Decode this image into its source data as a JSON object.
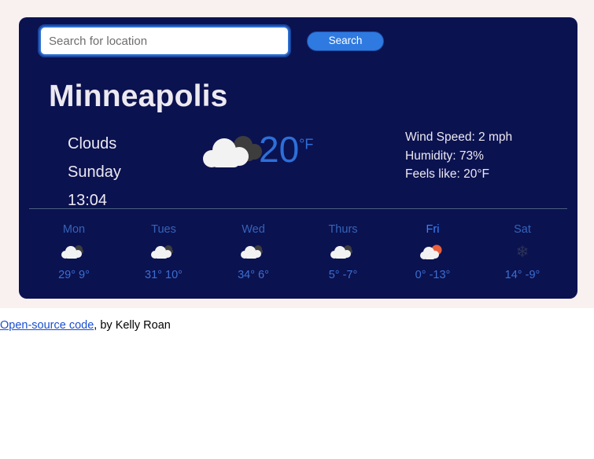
{
  "search": {
    "placeholder": "Search for location",
    "value": "",
    "button_label": "Search"
  },
  "current": {
    "city": "Minneapolis",
    "condition": "Clouds",
    "day": "Sunday",
    "time": "13:04",
    "temperature": "20",
    "unit": "°F",
    "icon": "broken-clouds-icon",
    "stats": [
      "Wind Speed: 2 mph",
      "Humidity: 73%",
      "Feels like: 20°F"
    ]
  },
  "forecast": [
    {
      "label": "Mon",
      "icon": "cloud-icon",
      "temps": "29° 9°",
      "highlight": false
    },
    {
      "label": "Tues",
      "icon": "cloud-icon",
      "temps": "31° 10°",
      "highlight": false
    },
    {
      "label": "Wed",
      "icon": "cloud-icon",
      "temps": "34° 6°",
      "highlight": false
    },
    {
      "label": "Thurs",
      "icon": "cloud-icon",
      "temps": "5° -7°",
      "highlight": false
    },
    {
      "label": "Fri",
      "icon": "sun-behind-cloud-icon",
      "temps": "0° -13°",
      "highlight": true
    },
    {
      "label": "Sat",
      "icon": "snowflake-icon",
      "temps": "14° -9°",
      "highlight": false
    }
  ],
  "footer": {
    "link_text": "Open-source code",
    "rest_text": ", by Kelly Roan"
  },
  "colors": {
    "card_background": "#0b1250",
    "accent_blue": "#2f7ae0",
    "temperature_blue": "#2d6fd8",
    "sun_orange": "#e8603c",
    "cloud_white": "#f2f2f2",
    "cloud_dark": "#3d3d3d"
  }
}
